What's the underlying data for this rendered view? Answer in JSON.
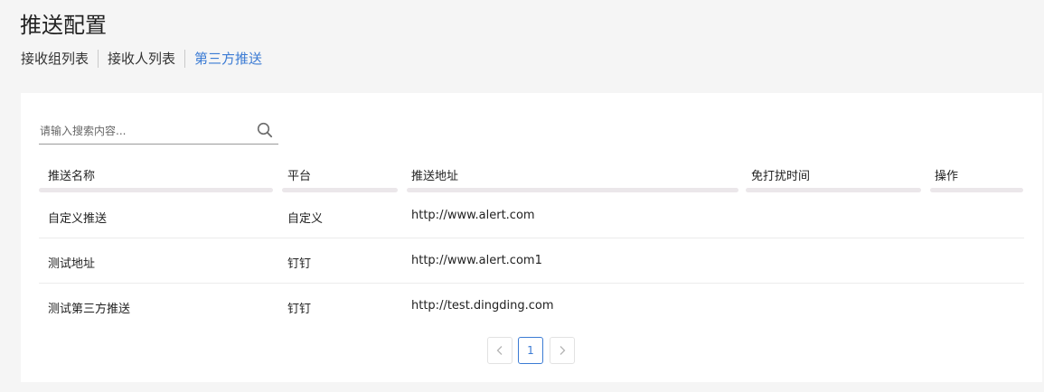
{
  "header": {
    "title": "推送配置"
  },
  "tabs": [
    {
      "label": "接收组列表",
      "active": false
    },
    {
      "label": "接收人列表",
      "active": false
    },
    {
      "label": "第三方推送",
      "active": true
    }
  ],
  "search": {
    "placeholder": "请输入搜索内容...",
    "value": "",
    "icon": "search-icon"
  },
  "table": {
    "columns": [
      "推送名称",
      "平台",
      "推送地址",
      "免打扰时间",
      "操作"
    ],
    "rows": [
      {
        "name": "自定义推送",
        "platform": "自定义",
        "url": "http://www.alert.com",
        "quiet_time": "",
        "actions": ""
      },
      {
        "name": "测试地址",
        "platform": "钉钉",
        "url": "http://www.alert.com1",
        "quiet_time": "",
        "actions": ""
      },
      {
        "name": "测试第三方推送",
        "platform": "钉钉",
        "url": "http://test.dingding.com",
        "quiet_time": "",
        "actions": ""
      }
    ]
  },
  "pagination": {
    "current": "1",
    "prev_icon": "chevron-left-icon",
    "next_icon": "chevron-right-icon"
  },
  "colors": {
    "accent": "#3b7bd4",
    "background": "#f5f5f5",
    "header_bar": "#ebe7ea"
  }
}
